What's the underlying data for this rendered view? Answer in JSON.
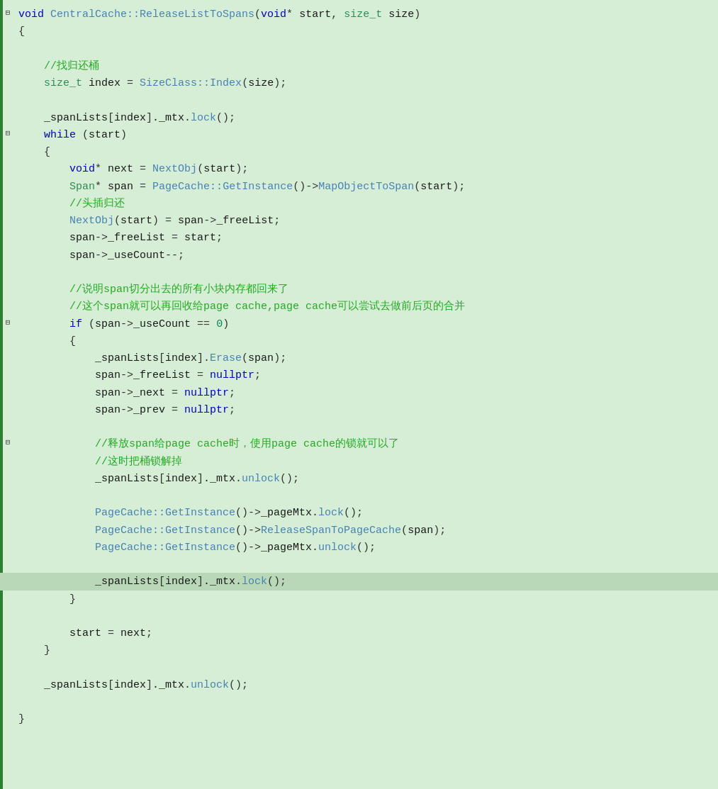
{
  "editor": {
    "background": "#d6edd6",
    "accent": "#2e7d32",
    "lines": [
      {
        "type": "func-header",
        "content": "void CentralCache::ReleaseListToSpans(void* start, size_t size)"
      },
      {
        "type": "brace-open",
        "content": "{",
        "fold": true,
        "foldLevel": 0
      },
      {
        "type": "blank"
      },
      {
        "type": "comment-line",
        "content": "    //找归还桶"
      },
      {
        "type": "code",
        "content": "    size_t index = SizeClass::Index(size);"
      },
      {
        "type": "blank"
      },
      {
        "type": "code",
        "content": "    _spanLists[index]._mtx.lock();"
      },
      {
        "type": "while",
        "content": "    while (start)",
        "fold": true
      },
      {
        "type": "brace-open",
        "content": "    {"
      },
      {
        "type": "code",
        "content": "        void* next = NextObj(start);"
      },
      {
        "type": "code",
        "content": "        Span* span = PageCache::GetInstance()->MapObjectToSpan(start);"
      },
      {
        "type": "comment-line",
        "content": "        //头插归还"
      },
      {
        "type": "code",
        "content": "        NextObj(start) = span->_freeList;"
      },
      {
        "type": "code",
        "content": "        span->_freeList = start;"
      },
      {
        "type": "code",
        "content": "        span->_useCount--;"
      },
      {
        "type": "blank"
      },
      {
        "type": "comment-line",
        "content": "        //说明span切分出去的所有小块内存都回来了"
      },
      {
        "type": "comment-line",
        "content": "        //这个span就可以再回收给page cache,page cache可以尝试去做前后页的合并"
      },
      {
        "type": "if",
        "content": "        if (span->_useCount == 0)",
        "fold": true
      },
      {
        "type": "brace-open",
        "content": "        {"
      },
      {
        "type": "code",
        "content": "            _spanLists[index].Erase(span);"
      },
      {
        "type": "code",
        "content": "            span->_freeList = nullptr;"
      },
      {
        "type": "code",
        "content": "            span->_next = nullptr;"
      },
      {
        "type": "code",
        "content": "            span->_prev = nullptr;"
      },
      {
        "type": "blank"
      },
      {
        "type": "comment-line",
        "content": "            //释放span给page cache时，使用page cache的锁就可以了",
        "fold": true
      },
      {
        "type": "comment-line",
        "content": "            //这时把桶锁解掉"
      },
      {
        "type": "code",
        "content": "            _spanLists[index]._mtx.unlock();"
      },
      {
        "type": "blank"
      },
      {
        "type": "code",
        "content": "            PageCache::GetInstance()->_pageMtx.lock();"
      },
      {
        "type": "code",
        "content": "            PageCache::GetInstance()->ReleaseSpanToPageCache(span);"
      },
      {
        "type": "code",
        "content": "            PageCache::GetInstance()->_pageMtx.unlock();"
      },
      {
        "type": "blank"
      },
      {
        "type": "code-highlighted",
        "content": "            _spanLists[index]._mtx.lock();"
      },
      {
        "type": "brace-close",
        "content": "        }"
      },
      {
        "type": "blank"
      },
      {
        "type": "code",
        "content": "        start = next;"
      },
      {
        "type": "brace-close",
        "content": "    }"
      },
      {
        "type": "blank"
      },
      {
        "type": "code",
        "content": "    _spanLists[index]._mtx.unlock();"
      },
      {
        "type": "blank"
      },
      {
        "type": "brace-close",
        "content": "}"
      }
    ]
  }
}
